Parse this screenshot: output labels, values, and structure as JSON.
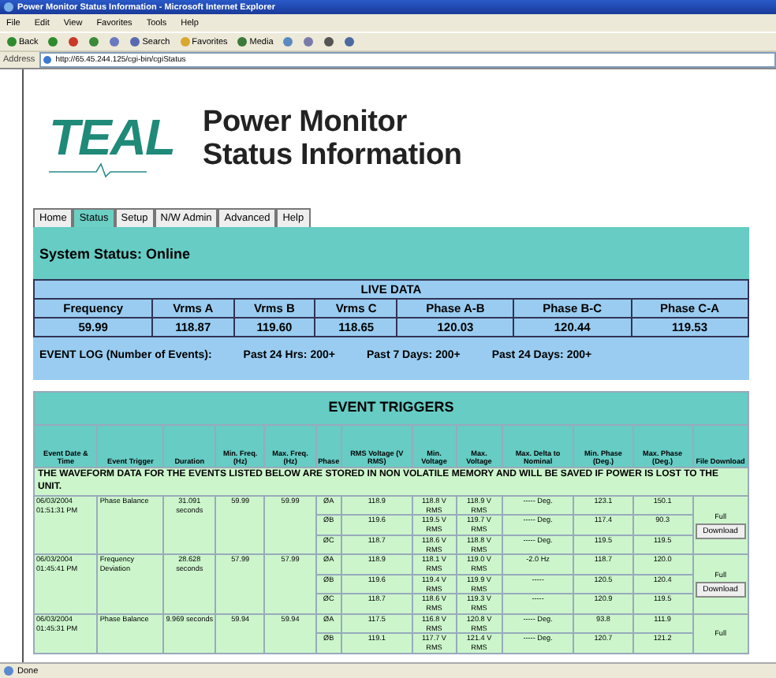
{
  "window": {
    "title": "Power Monitor Status Information - Microsoft Internet Explorer"
  },
  "menu": [
    "File",
    "Edit",
    "View",
    "Favorites",
    "Tools",
    "Help"
  ],
  "toolbar": [
    {
      "kind": "back",
      "label": "Back"
    },
    {
      "kind": "forward"
    },
    {
      "kind": "stop"
    },
    {
      "kind": "refresh"
    },
    {
      "kind": "home"
    },
    {
      "kind": "search",
      "label": "Search"
    },
    {
      "kind": "favorites",
      "label": "Favorites"
    },
    {
      "kind": "media",
      "label": "Media"
    },
    {
      "kind": "history"
    },
    {
      "kind": "mail"
    },
    {
      "kind": "print"
    },
    {
      "kind": "edit"
    }
  ],
  "address": {
    "label": "Address",
    "value": "http://65.45.244.125/cgi-bin/cgiStatus"
  },
  "logo": {
    "text": "TEAL"
  },
  "heading": [
    "Power Monitor",
    "Status Information"
  ],
  "tabs": [
    {
      "label": "Home",
      "selected": false
    },
    {
      "label": "Status",
      "selected": true
    },
    {
      "label": "Setup",
      "selected": false
    },
    {
      "label": "N/W Admin",
      "selected": false
    },
    {
      "label": "Advanced",
      "selected": false
    },
    {
      "label": "Help",
      "selected": false
    }
  ],
  "system_status": "System Status: Online",
  "live_data": {
    "title": "LIVE DATA",
    "columns": [
      "Frequency",
      "Vrms A",
      "Vrms B",
      "Vrms C",
      "Phase A-B",
      "Phase B-C",
      "Phase C-A"
    ],
    "values": [
      "59.99",
      "118.87",
      "119.60",
      "118.65",
      "120.03",
      "120.44",
      "119.53"
    ]
  },
  "event_log": {
    "label": "EVENT LOG (Number of Events):",
    "counts": [
      "Past 24 Hrs:  200+",
      "Past 7 Days:  200+",
      "Past 24 Days:  200+"
    ]
  },
  "event_triggers": {
    "title": "EVENT TRIGGERS",
    "columns": [
      "Event Date & Time",
      "Event Trigger",
      "Duration",
      "Min. Freq. (Hz)",
      "Max. Freq. (Hz)",
      "Phase",
      "RMS Voltage (V RMS)",
      "Min. Voltage",
      "Max. Voltage",
      "Max. Delta to Nominal",
      "Min. Phase (Deg.)",
      "Max. Phase (Deg.)",
      "File Download"
    ],
    "notice": "THE WAVEFORM DATA FOR THE EVENTS LISTED BELOW ARE STORED IN NON VOLATILE MEMORY AND WILL BE SAVED IF POWER IS LOST TO THE UNIT.",
    "events": [
      {
        "date": "06/03/2004",
        "time": "01:51:31 PM",
        "trigger": "Phase Balance",
        "duration": "31.091 seconds",
        "min_freq": "59.99",
        "max_freq": "59.99",
        "file_label": "Full",
        "button": "Download",
        "phases": [
          [
            "ØA",
            "118.9",
            "118.8 V RMS",
            "118.9 V RMS",
            "----- Deg.",
            "123.1",
            "150.1"
          ],
          [
            "ØB",
            "119.6",
            "119.5 V RMS",
            "119.7 V RMS",
            "----- Deg.",
            "117.4",
            "90.3"
          ],
          [
            "ØC",
            "118.7",
            "118.6 V RMS",
            "118.8 V RMS",
            "----- Deg.",
            "119.5",
            "119.5"
          ]
        ]
      },
      {
        "date": "06/03/2004",
        "time": "01:45:41 PM",
        "trigger": "Frequency Deviation",
        "duration": "28.628 seconds",
        "min_freq": "57.99",
        "max_freq": "57.99",
        "file_label": "Full",
        "button": "Download",
        "phases": [
          [
            "ØA",
            "118.9",
            "118.1 V RMS",
            "119.0 V RMS",
            "-2.0 Hz",
            "118.7",
            "120.0"
          ],
          [
            "ØB",
            "119.6",
            "119.4 V RMS",
            "119.9 V RMS",
            "-----",
            "120.5",
            "120.4"
          ],
          [
            "ØC",
            "118.7",
            "118.6 V RMS",
            "119.3 V RMS",
            "-----",
            "120.9",
            "119.5"
          ]
        ]
      },
      {
        "date": "06/03/2004",
        "time": "01:45:31 PM",
        "trigger": "Phase Balance",
        "duration": "9.969 seconds",
        "min_freq": "59.94",
        "max_freq": "59.94",
        "file_label": "Full",
        "phases": [
          [
            "ØA",
            "117.5",
            "116.8 V RMS",
            "120.8 V RMS",
            "----- Deg.",
            "93.8",
            "111.9"
          ],
          [
            "ØB",
            "119.1",
            "117.7 V RMS",
            "121.4 V RMS",
            "----- Deg.",
            "120.7",
            "121.2"
          ]
        ]
      }
    ]
  },
  "status_bar": "Done"
}
